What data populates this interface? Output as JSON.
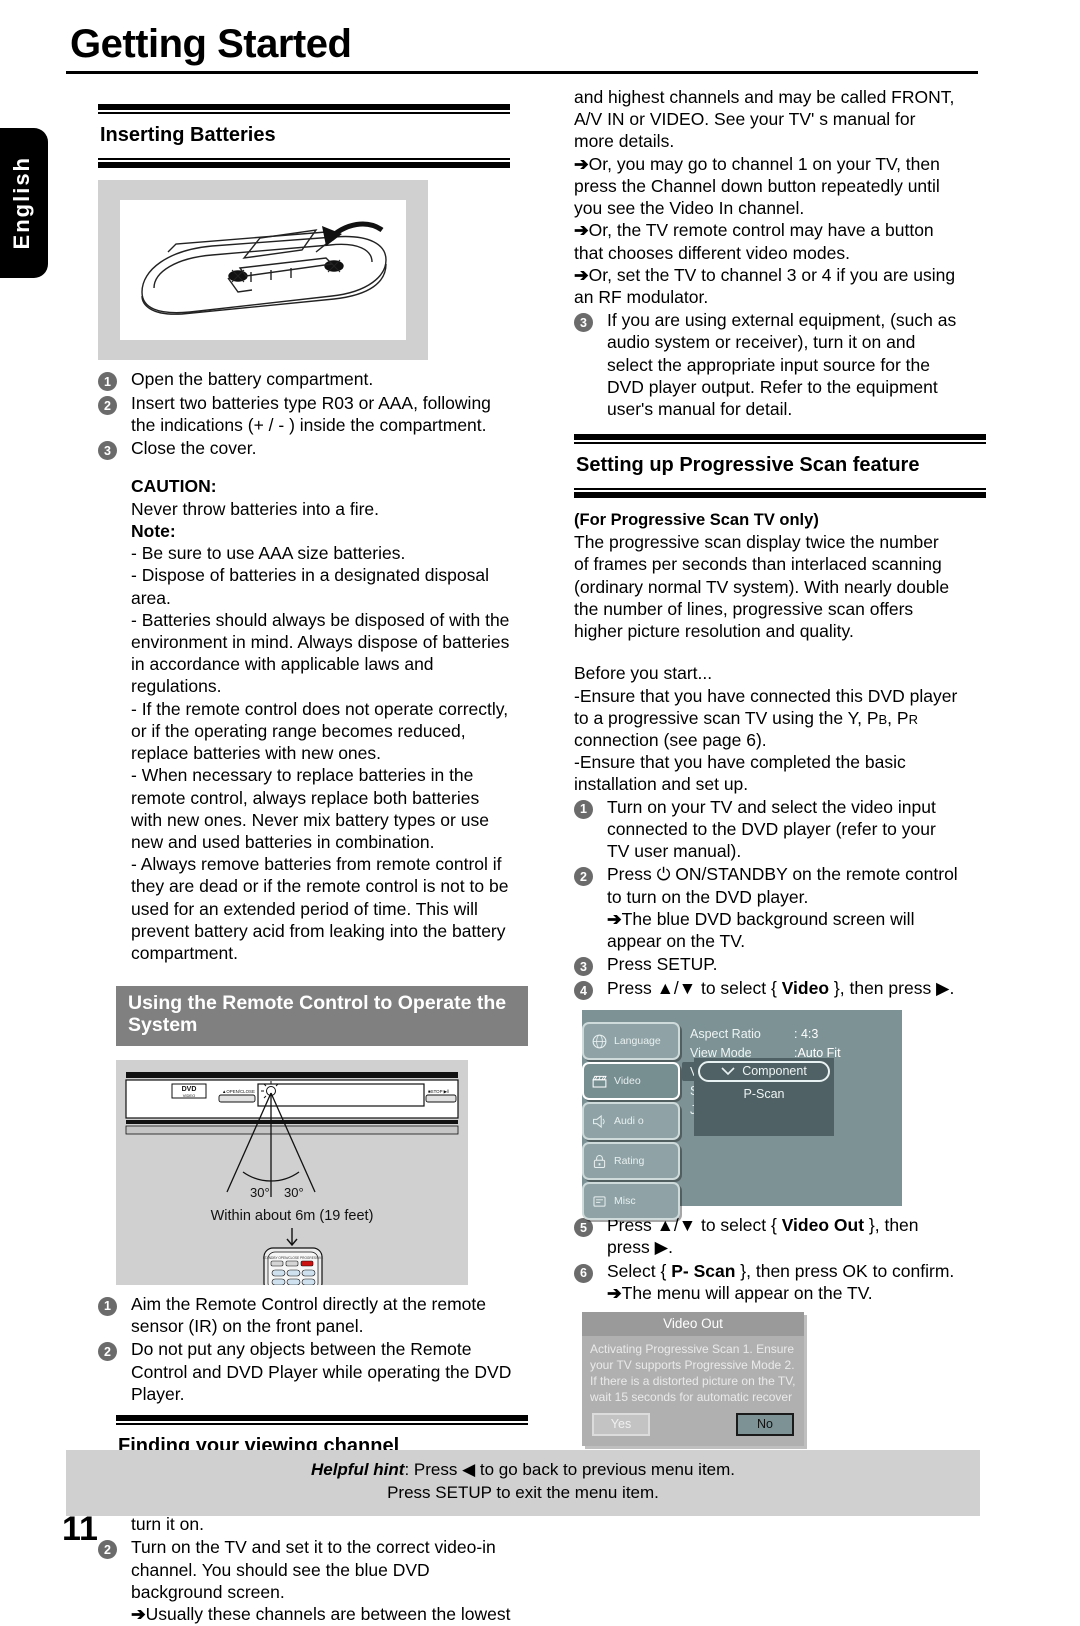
{
  "language_tab": "English",
  "page_title": "Getting Started",
  "page_number": "11",
  "left": {
    "heading_batteries": "Inserting Batteries",
    "battery_steps": [
      "Open the battery compartment.",
      "Insert two batteries type R03 or AAA, following the indications (+ / - ) inside the compartment.",
      "Close the cover."
    ],
    "caution_label": "CAUTION:",
    "caution_text": "Never throw batteries into a fire.",
    "note_label": "Note:",
    "notes": [
      "- Be sure to use AAA size batteries.",
      "- Dispose of batteries in a designated disposal area.",
      "- Batteries should always be disposed of with the environment in mind. Always dispose of batteries in accordance with applicable laws and regulations.",
      "- If the remote control does not operate correctly, or if the operating range becomes reduced, replace batteries with new ones.",
      "- When necessary to replace batteries in the remote control, always replace both batteries with new ones. Never mix battery types or use new and used batteries in combination.",
      "- Always remove batteries from remote control if they are dead or if the remote control is not to be used for an extended period of time. This will prevent battery acid from leaking into the battery compartment."
    ],
    "banner_remote": "Using the Remote Control to Operate the System",
    "diagram": {
      "angle_left": "30°",
      "angle_right": "30°",
      "distance_caption": "Within about 6m (19 feet)",
      "dvd_logo": "DVD",
      "open_close_label": "OPEN/CLOSE",
      "stop_label": "STOP"
    },
    "remote_steps": [
      "Aim the Remote Control directly at the remote sensor (IR) on the front panel.",
      "Do not put any objects between the Remote Control and DVD Player while operating the DVD Player."
    ],
    "heading_channel": "Finding your viewing channel",
    "channel_steps": [
      "Press I/⏻ ON/STANDBY on the DVD player to turn it on.",
      "Turn on the TV and set it to the correct video-in channel. You should see the blue DVD background screen."
    ],
    "channel_arrow_note": "Usually these channels are between the lowest"
  },
  "right": {
    "continuation": "and highest channels and may be called FRONT, A/V IN or VIDEO. See your TV' s manual for more details.",
    "arrow_notes": [
      "Or, you may go to channel 1 on your TV, then press the Channel down button repeatedly until you see the Video In channel.",
      "Or, the TV remote control may have a button that chooses different video modes.",
      "Or, set the TV to channel 3 or 4 if you are using an RF modulator."
    ],
    "step3": "If you are using external equipment, (such as audio  system or receiver), turn it on and select the appropriate input source for the DVD player output. Refer to the equipment user's manual for detail.",
    "heading_pscan": "Setting up Progressive Scan feature",
    "pscan_only": "(For Progressive Scan TV only)",
    "pscan_desc": "The progressive scan display twice the number of frames per seconds than interlaced scanning (ordinary normal TV system). With nearly double the number of lines, progressive scan offers higher picture resolution and quality.",
    "before_label": "Before you start...",
    "before_items": [
      "-Ensure that you have connected this DVD player to a progressive scan TV using the Y, PB, PR connection (see page 6).",
      "-Ensure that you have completed the basic installation and set up."
    ],
    "steps": [
      "Turn on your TV and select the video input connected to the DVD player (refer to your TV user manual).",
      "Press ⏻ ON/STANDBY on the remote control to turn on the DVD player.",
      "Press SETUP.",
      "Press ▲/▼ to select { Video }, then press ▶.",
      "Press ▲/▼ to select { Video Out }, then press ▶.",
      "Select { P- Scan }, then press OK to confirm."
    ],
    "step2_arrow": "The blue DVD background screen will appear on the TV.",
    "step6_arrow": "The menu will appear on the TV.",
    "setup_menu": {
      "sidebar": [
        {
          "label": "Language",
          "icon": "globe-icon",
          "active": false
        },
        {
          "label": "Video",
          "icon": "clapperboard-icon",
          "active": true
        },
        {
          "label": "Audi o",
          "icon": "speaker-icon",
          "active": false
        },
        {
          "label": "Rating",
          "icon": "lock-icon",
          "active": false
        },
        {
          "label": "Misc",
          "icon": "misc-icon",
          "active": false
        }
      ],
      "rows": [
        {
          "key": "Aspect Ratio",
          "value": ": 4:3",
          "selected": false
        },
        {
          "key": "View Mode",
          "value": ":Auto Fit",
          "selected": false
        },
        {
          "key": "Video Out",
          "value": "",
          "selected": true
        },
        {
          "key": "Smart Picture",
          "value": "",
          "selected": false
        },
        {
          "key": "JPEG Interval",
          "value": "",
          "selected": false
        }
      ],
      "popup_options": [
        {
          "label": "Component",
          "current": true
        },
        {
          "label": "P-Scan",
          "current": false
        }
      ]
    },
    "video_out_dialog": {
      "title": "Video Out",
      "body": "Activating Progressive Scan 1. Ensure your TV supports Progressive Mode 2. If there is a distorted picture on the TV, wait 15 seconds for automatic recover",
      "yes": "Yes",
      "no": "No"
    }
  },
  "footer": {
    "hint_label": "Helpful hint",
    "hint_line1": ":  Press ◀ to go back to previous menu item.",
    "hint_line2": "Press SETUP to exit the menu item."
  }
}
